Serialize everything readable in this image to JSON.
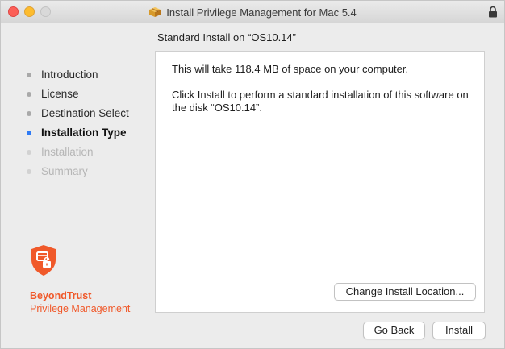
{
  "window": {
    "title": "Install Privilege Management for Mac 5.4"
  },
  "header": {
    "subtitle": "Standard Install on “OS10.14”"
  },
  "sidebar": {
    "steps": [
      {
        "label": "Introduction",
        "state": "done"
      },
      {
        "label": "License",
        "state": "done"
      },
      {
        "label": "Destination Select",
        "state": "done"
      },
      {
        "label": "Installation Type",
        "state": "current"
      },
      {
        "label": "Installation",
        "state": "future"
      },
      {
        "label": "Summary",
        "state": "future"
      }
    ]
  },
  "brand": {
    "name": "BeyondTrust",
    "product": "Privilege Management",
    "color": "#f0592a"
  },
  "main": {
    "space_text": "This will take 118.4 MB of space on your computer.",
    "install_text": "Click Install to perform a standard installation of this software on the disk “OS10.14”.",
    "change_location_label": "Change Install Location..."
  },
  "footer": {
    "back_label": "Go Back",
    "install_label": "Install"
  },
  "colors": {
    "current_step_dot": "#2f7bf5"
  }
}
